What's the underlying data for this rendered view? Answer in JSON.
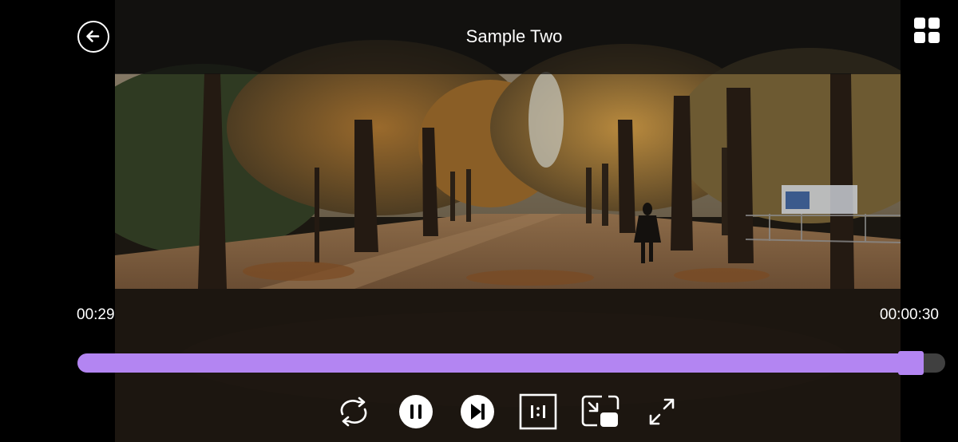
{
  "header": {
    "title": "Sample Two",
    "back_icon": "arrow-left-circle-icon",
    "menu_icon": "grid-icon"
  },
  "playback": {
    "current_time": "00:29",
    "total_time": "00:00:30",
    "progress": 0.97,
    "state": "playing"
  },
  "controls": {
    "repeat_icon": "repeat-icon",
    "pause_icon": "pause-circle-icon",
    "next_icon": "skip-next-circle-icon",
    "aspect_icon": "aspect-ratio-icon",
    "pip_icon": "picture-in-picture-icon",
    "fullscreen_icon": "fullscreen-icon"
  },
  "colors": {
    "accent": "#b385f2",
    "foreground": "#ffffff",
    "background": "#000000"
  }
}
